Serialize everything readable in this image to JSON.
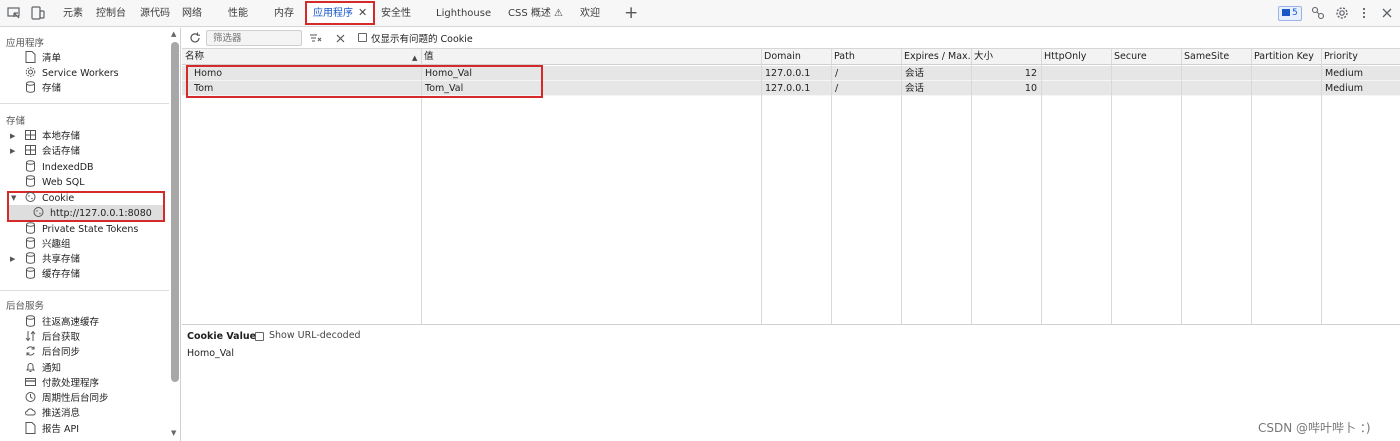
{
  "topbar": {
    "tabs": [
      {
        "label": "元素"
      },
      {
        "label": "控制台"
      },
      {
        "label": "源代码"
      },
      {
        "label": "网络"
      },
      {
        "label": "性能"
      },
      {
        "label": "内存"
      },
      {
        "label": "应用程序"
      },
      {
        "label": "安全性"
      },
      {
        "label": "Lighthouse"
      },
      {
        "label": "CSS 概述 ⚠"
      },
      {
        "label": "欢迎"
      }
    ],
    "close_glyph": "✕",
    "plus_glyph": "+",
    "issues_count": "5"
  },
  "sidebar": {
    "sections": {
      "app": "应用程序",
      "storage": "存储",
      "background": "后台服务"
    },
    "app_items": [
      {
        "label": "清单",
        "icon": "file-icon"
      },
      {
        "label": "Service Workers",
        "icon": "gear-icon"
      },
      {
        "label": "存储",
        "icon": "database-icon"
      }
    ],
    "storage_items": [
      {
        "label": "本地存储",
        "icon": "table-icon"
      },
      {
        "label": "会话存储",
        "icon": "table-icon"
      },
      {
        "label": "IndexedDB",
        "icon": "database-icon"
      },
      {
        "label": "Web SQL",
        "icon": "database-icon"
      },
      {
        "label": "Cookie",
        "icon": "cookie-icon"
      },
      {
        "label": "http://127.0.0.1:8080",
        "icon": "cookie-icon"
      },
      {
        "label": "Private State Tokens",
        "icon": "database-icon"
      },
      {
        "label": "兴趣组",
        "icon": "database-icon"
      },
      {
        "label": "共享存储",
        "icon": "database-icon"
      },
      {
        "label": "缓存存储",
        "icon": "database-icon"
      }
    ],
    "background_items": [
      {
        "label": "往返高速缓存",
        "icon": "database-icon"
      },
      {
        "label": "后台获取",
        "icon": "fetch-icon"
      },
      {
        "label": "后台同步",
        "icon": "sync-icon"
      },
      {
        "label": "通知",
        "icon": "bell-icon"
      },
      {
        "label": "付款处理程序",
        "icon": "card-icon"
      },
      {
        "label": "周期性后台同步",
        "icon": "clock-icon"
      },
      {
        "label": "推送消息",
        "icon": "cloud-icon"
      },
      {
        "label": "报告 API",
        "icon": "file-icon"
      }
    ]
  },
  "toolbar": {
    "filter_placeholder": "筛选器",
    "only_issues_label": "仅显示有问题的 Cookie"
  },
  "table": {
    "columns": [
      "名称",
      "值",
      "Domain",
      "Path",
      "Expires / Max...",
      "大小",
      "HttpOnly",
      "Secure",
      "SameSite",
      "Partition Key",
      "Priority"
    ],
    "rows": [
      {
        "name": "Homo",
        "value": "Homo_Val",
        "domain": "127.0.0.1",
        "path": "/",
        "expires": "会话",
        "size": "12",
        "httponly": "",
        "secure": "",
        "samesite": "",
        "partition": "",
        "priority": "Medium"
      },
      {
        "name": "Tom",
        "value": "Tom_Val",
        "domain": "127.0.0.1",
        "path": "/",
        "expires": "会话",
        "size": "10",
        "httponly": "",
        "secure": "",
        "samesite": "",
        "partition": "",
        "priority": "Medium"
      }
    ]
  },
  "cookie_value_panel": {
    "title": "Cookie Value",
    "decode_label": "Show URL-decoded",
    "value": "Homo_Val"
  },
  "watermark": "CSDN @哔叶哔卜 ：)"
}
